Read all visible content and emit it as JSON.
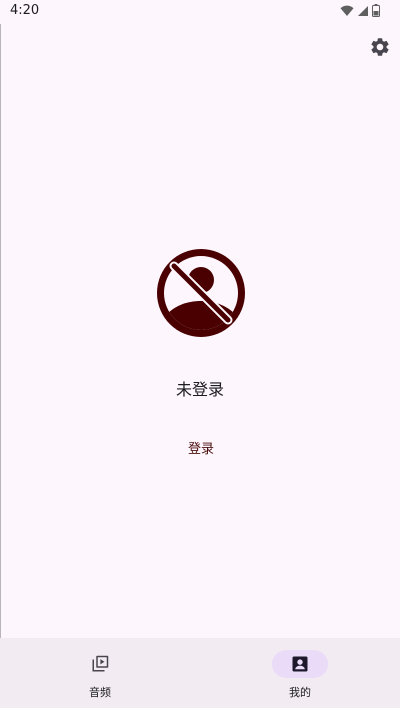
{
  "status_bar": {
    "time": "4:20",
    "icons": [
      "wifi-icon",
      "signal-icon",
      "battery-icon"
    ]
  },
  "header": {
    "settings_icon": "gear-icon"
  },
  "profile": {
    "avatar_icon": "no-user-avatar-icon",
    "status_text": "未登录",
    "login_label": "登录"
  },
  "bottom_nav": {
    "items": [
      {
        "label": "音频",
        "icon": "play-library-icon",
        "selected": false
      },
      {
        "label": "我的",
        "icon": "account-box-icon",
        "selected": true
      }
    ]
  },
  "colors": {
    "background": "#fdf7fd",
    "avatar": "#4a0000",
    "nav_background": "#f2ecf2",
    "nav_indicator": "#eadcf8"
  }
}
